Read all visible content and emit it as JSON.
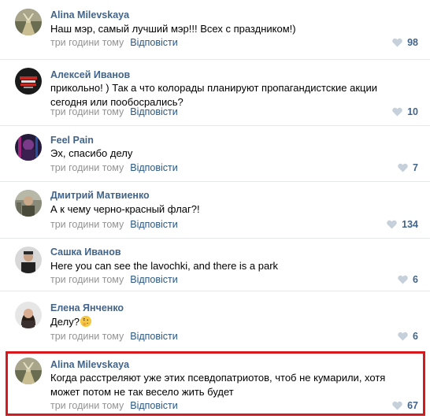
{
  "comments": [
    {
      "author": "Alina Milevskaya",
      "text": "Наш мэр, самый лучший мэр!!! Всех с праздником!)",
      "time": "три години тому",
      "reply": "Відповісти",
      "likes": "98",
      "avatar": "avatar-alina"
    },
    {
      "author": "Алексей Иванов",
      "text": "прикольно! ) Так а что колорады планируют пропагандистские акции сегодня или пообосрались?",
      "time": "три години тому",
      "reply": "Відповісти",
      "likes": "10",
      "avatar": "avatar-aleksey"
    },
    {
      "author": "Feel Pain",
      "text": "Эх, спасибо делу",
      "time": "три години тому",
      "reply": "Відповісти",
      "likes": "7",
      "avatar": "avatar-feelpain"
    },
    {
      "author": "Дмитрий Матвиенко",
      "text": "А к чему черно-красный флаг?!",
      "time": "три години тому",
      "reply": "Відповісти",
      "likes": "134",
      "avatar": "avatar-dmitriy"
    },
    {
      "author": "Сашка Иванов",
      "text": "Here you can see the lavochki, and there is a park",
      "time": "три години тому",
      "reply": "Відповісти",
      "likes": "6",
      "avatar": "avatar-sashka"
    },
    {
      "author": "Елена Янченко",
      "text": "Делу?",
      "time": "три години тому",
      "reply": "Відповісти",
      "likes": "6",
      "avatar": "avatar-elena",
      "emoji": "thinking-face-emoji"
    },
    {
      "author": "Alina Milevskaya",
      "text": "Когда расстреляют уже этих псевдопатриотов, чтоб не кумарили, хотя может потом не так весело жить будет",
      "time": "три години тому",
      "reply": "Відповісти",
      "likes": "67",
      "avatar": "avatar-alina",
      "highlighted": true
    }
  ],
  "colors": {
    "author": "#42648b",
    "reply": "#2a5885",
    "time": "#939393",
    "like": "#42648b",
    "highlight": "#d7191d"
  }
}
